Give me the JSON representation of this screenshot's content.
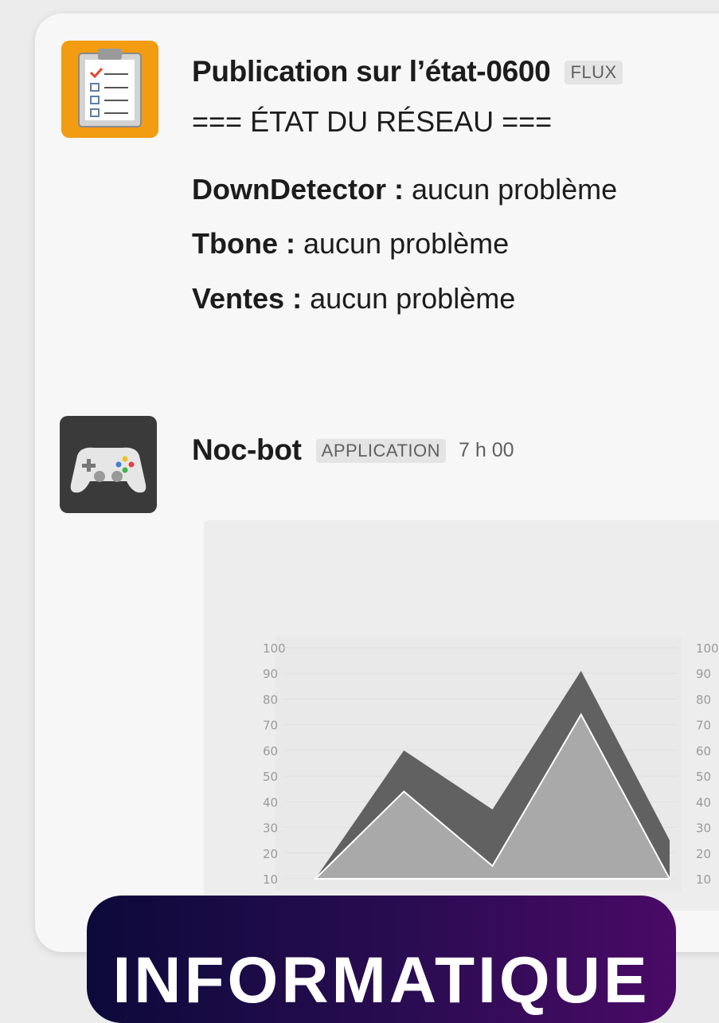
{
  "messages": [
    {
      "sender": "Publication sur l’état-0600",
      "badge": "FLUX",
      "title": "=== ÉTAT DU RÉSEAU ===",
      "lines": [
        {
          "label": "DownDetector :",
          "value": " aucun problème"
        },
        {
          "label": "Tbone :",
          "value": " aucun problème"
        },
        {
          "label": "Ventes :",
          "value": " aucun problème"
        }
      ],
      "icon": "clipboard-checklist-icon"
    },
    {
      "sender": "Noc-bot",
      "badge": "APPLICATION",
      "time": "7 h 00",
      "icon": "gamepad-icon"
    }
  ],
  "chart_data": {
    "type": "area",
    "yticks": [
      "100",
      "90",
      "80",
      "70",
      "60",
      "50",
      "40",
      "30",
      "20",
      "10"
    ],
    "ylim": [
      10,
      100
    ],
    "x": [
      0,
      1,
      2,
      3,
      4
    ],
    "series": [
      {
        "values": [
          10,
          60,
          37,
          91,
          25
        ],
        "color": "#616161"
      },
      {
        "values": [
          10,
          44,
          15,
          74,
          10
        ],
        "color": "#a9a9a9"
      }
    ],
    "second_axis_ticks": [
      "100",
      "90",
      "80",
      "70",
      "60",
      "50",
      "40",
      "30",
      "20",
      "10"
    ]
  },
  "banner": {
    "text": "INFORMATIQUE"
  },
  "colors": {
    "banner_start": "#0c0a3a",
    "banner_end": "#4a0a66",
    "avatar_orange": "#f29c11"
  }
}
